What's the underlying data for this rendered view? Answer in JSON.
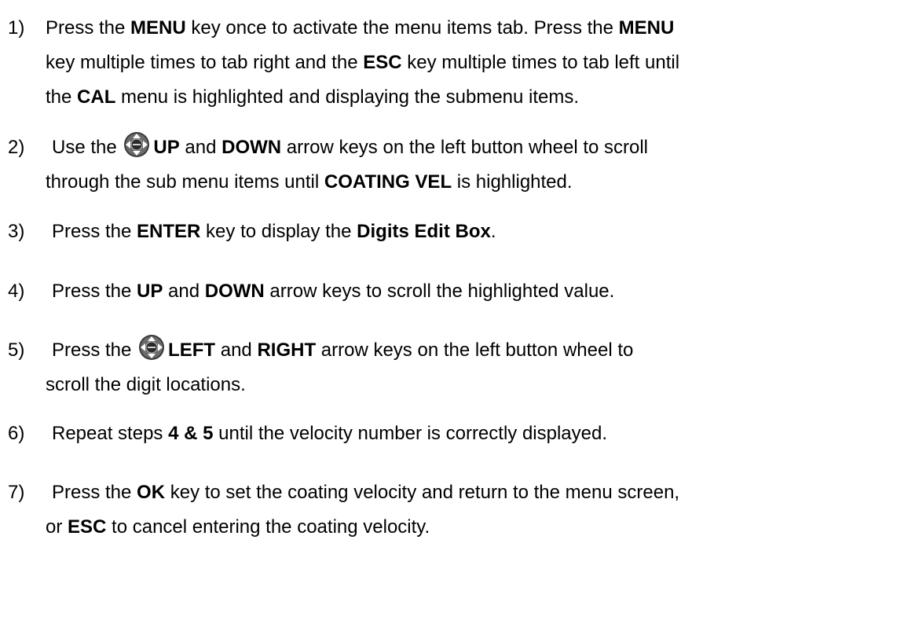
{
  "steps": [
    {
      "number": "1)",
      "lines": [
        [
          {
            "t": "Press the ",
            "b": false
          },
          {
            "t": "MENU",
            "b": true
          },
          {
            "t": " key once to activate the menu items tab.  Press the ",
            "b": false
          },
          {
            "t": "MENU",
            "b": true
          }
        ],
        [
          {
            "t": "key multiple times to tab right and the ",
            "b": false
          },
          {
            "t": "ESC",
            "b": true
          },
          {
            "t": " key multiple times to tab left until",
            "b": false
          }
        ],
        [
          {
            "t": "the ",
            "b": false
          },
          {
            "t": "CAL",
            "b": true
          },
          {
            "t": " menu is highlighted and displaying the submenu items.",
            "b": false
          }
        ]
      ]
    },
    {
      "number": "2)",
      "lines": [
        [
          {
            "t": "Use the ",
            "b": false
          },
          {
            "icon": "button-wheel-icon"
          },
          {
            "t": "UP",
            "b": true
          },
          {
            "t": " and ",
            "b": false
          },
          {
            "t": "DOWN",
            "b": true
          },
          {
            "t": " arrow keys on the left button wheel to scroll",
            "b": false
          }
        ],
        [
          {
            "t": "through the sub menu items until ",
            "b": false
          },
          {
            "t": "COATING VEL",
            "b": true
          },
          {
            "t": " is highlighted.",
            "b": false
          }
        ]
      ]
    },
    {
      "number": "3)",
      "lines": [
        [
          {
            "t": "Press the ",
            "b": false
          },
          {
            "t": "ENTER",
            "b": true
          },
          {
            "t": " key to display the ",
            "b": false
          },
          {
            "t": "Digits Edit Box",
            "b": true
          },
          {
            "t": ".",
            "b": false
          }
        ]
      ]
    },
    {
      "number": "4)",
      "lines": [
        [
          {
            "t": "Press the ",
            "b": false
          },
          {
            "t": "UP",
            "b": true
          },
          {
            "t": " and ",
            "b": false
          },
          {
            "t": "DOWN",
            "b": true
          },
          {
            "t": " arrow keys to scroll the highlighted value.",
            "b": false
          }
        ]
      ]
    },
    {
      "number": "5)",
      "lines": [
        [
          {
            "t": "Press the ",
            "b": false
          },
          {
            "icon": "button-wheel-icon"
          },
          {
            "t": "LEFT",
            "b": true
          },
          {
            "t": " and ",
            "b": false
          },
          {
            "t": "RIGHT",
            "b": true
          },
          {
            "t": " arrow keys on the left button wheel to",
            "b": false
          }
        ],
        [
          {
            "t": "scroll the digit locations.",
            "b": false
          }
        ]
      ]
    },
    {
      "number": "6)",
      "lines": [
        [
          {
            "t": "Repeat steps ",
            "b": false
          },
          {
            "t": "4 & 5",
            "b": true
          },
          {
            "t": " until the velocity number is correctly displayed.",
            "b": false
          }
        ]
      ]
    },
    {
      "number": "7)",
      "lines": [
        [
          {
            "t": "Press the ",
            "b": false
          },
          {
            "t": "OK",
            "b": true
          },
          {
            "t": " key to set the coating velocity and return to the menu screen,",
            "b": false
          }
        ],
        [
          {
            "t": "or ",
            "b": false
          },
          {
            "t": "ESC",
            "b": true
          },
          {
            "t": " to cancel entering the coating velocity.",
            "b": false
          }
        ]
      ]
    }
  ]
}
